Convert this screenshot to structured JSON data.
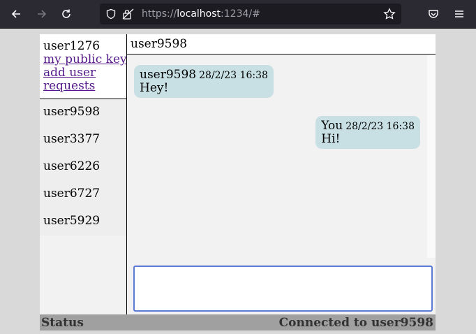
{
  "browser": {
    "url_prefix": "https://",
    "url_host": "localhost",
    "url_rest": ":1234/#"
  },
  "sidebar": {
    "current_user": "user1276",
    "links": [
      "my public key",
      "add user",
      "requests"
    ],
    "contacts": [
      "user9598",
      "user3377",
      "user6226",
      "user6727",
      "user5929"
    ]
  },
  "chat": {
    "title": "user9598",
    "messages": [
      {
        "sender": "user9598",
        "time": "28/2/23 16:38",
        "text": "Hey!"
      },
      {
        "sender": "You",
        "time": "28/2/23 16:38",
        "text": "Hi!"
      }
    ],
    "input_value": ""
  },
  "status": {
    "label": "Status",
    "value": "Connected to user9598"
  },
  "colors": {
    "bubble": "#c8e0e4",
    "link": "#551a8b",
    "input_border": "#5b7ad6"
  }
}
